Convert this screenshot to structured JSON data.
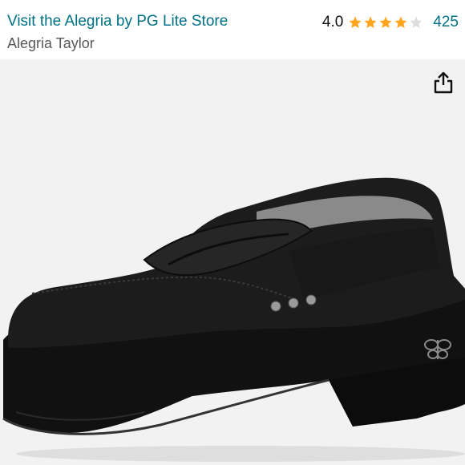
{
  "header": {
    "store_link": "Visit the Alegria by PG Lite Store",
    "product_title": "Alegria Taylor",
    "rating_value": "4.0",
    "stars_filled": 4,
    "stars_total": 5,
    "review_count": "425"
  },
  "icons": {
    "share": "share-icon",
    "star": "star-icon"
  },
  "colors": {
    "link": "#007185",
    "secondary_text": "#565959",
    "star": "#FFA41C",
    "star_empty": "#DDDDDD",
    "image_bg": "#F2F2F2"
  }
}
